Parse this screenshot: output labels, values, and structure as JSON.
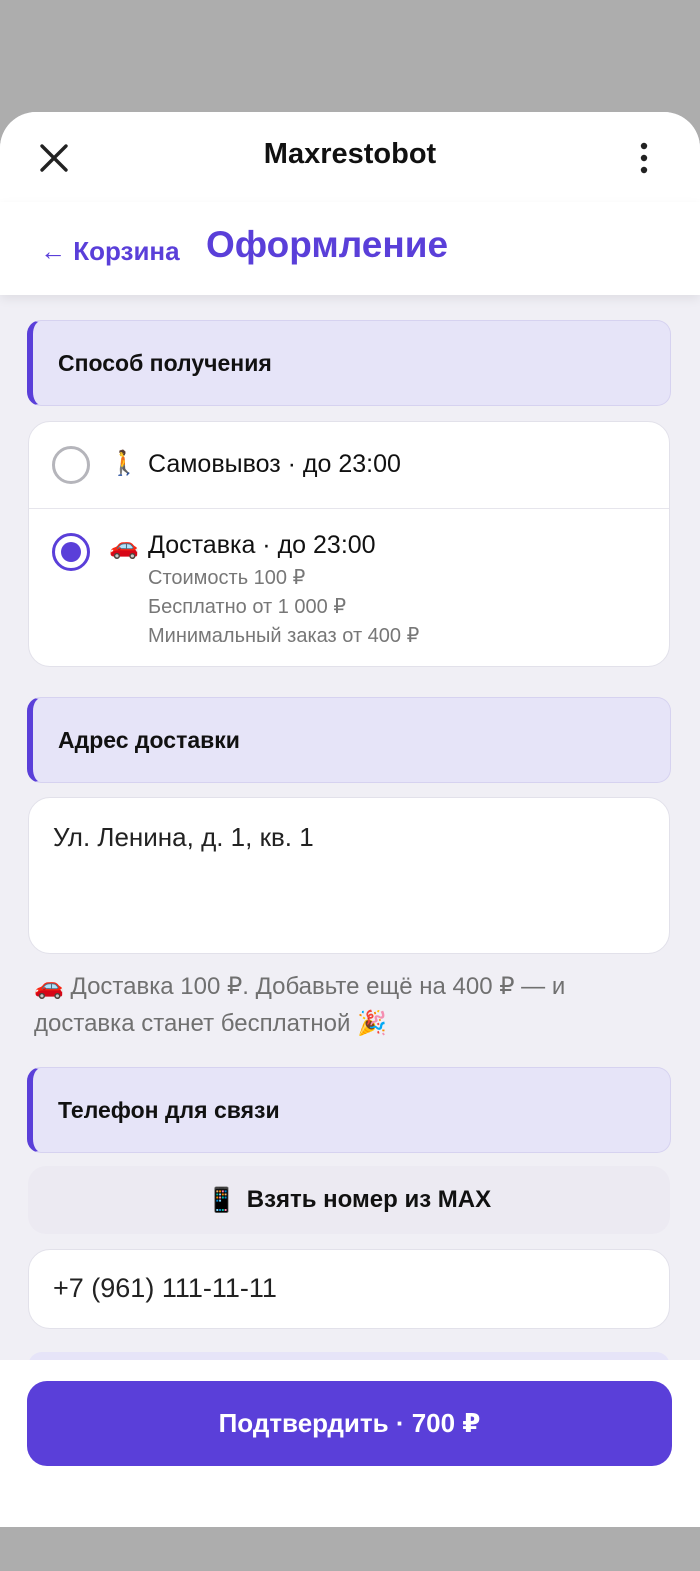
{
  "app": {
    "title": "Maxrestobot"
  },
  "nav": {
    "back_label": "← Корзина",
    "page_title": "Оформление"
  },
  "sections": {
    "pickup_method": "Способ получения",
    "delivery_address": "Адрес доставки",
    "contact_phone": "Телефон для связи"
  },
  "options": [
    {
      "emoji": "🚶",
      "label": "Самовывоз · до 23:00",
      "selected": false,
      "details": []
    },
    {
      "emoji": "🚗",
      "label": "Доставка · до 23:00",
      "selected": true,
      "details": [
        "Стоимость 100 ₽",
        "Бесплатно от 1 000 ₽",
        "Минимальный заказ от 400 ₽"
      ]
    }
  ],
  "address": {
    "value": "Ул. Ленина, д. 1, кв. 1"
  },
  "hint": {
    "text": "🚗 Доставка 100 ₽. Добавьте ещё на 400 ₽ — и доставка станет бесплатной 🎉"
  },
  "phone": {
    "take_button_emoji": "📱",
    "take_button_label": "Взять номер из MAX",
    "value": "+7 (961) 111-11-11"
  },
  "footer": {
    "confirm_label": "Подтвердить · 700 ₽"
  },
  "colors": {
    "accent": "#5a3fd9",
    "section_bg": "#e6e4f8",
    "page_bg": "#f0eff5"
  }
}
